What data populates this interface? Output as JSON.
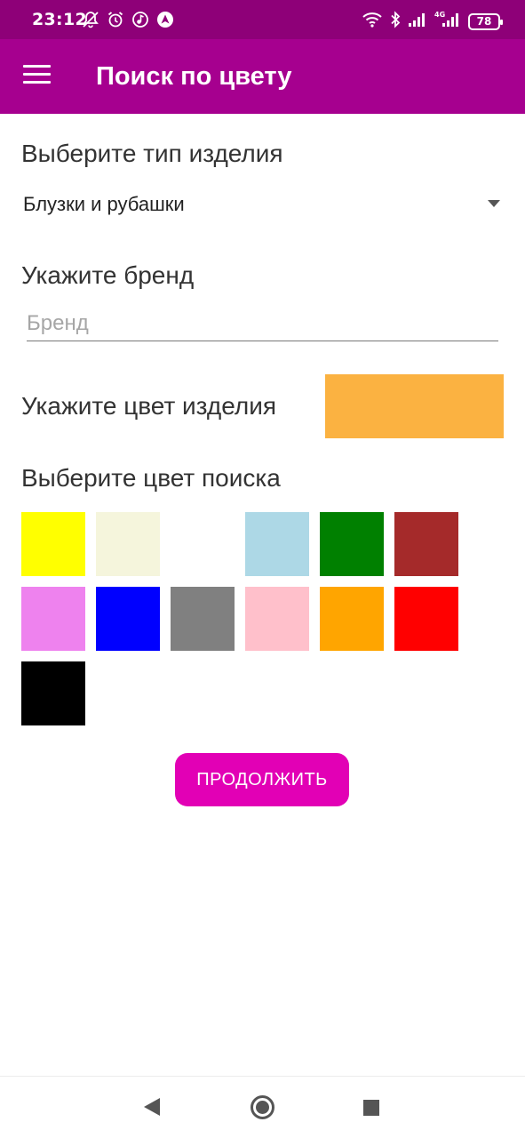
{
  "status_bar": {
    "time": "23:12",
    "battery": "78",
    "network": "4G",
    "left_icons": [
      "notifications-off-icon",
      "alarm-icon",
      "music-icon",
      "nav-app-icon"
    ],
    "right_icons": [
      "wifi-icon",
      "bluetooth-icon",
      "signal-icon",
      "signal-4g-icon",
      "battery-icon"
    ]
  },
  "app_bar": {
    "title": "Поиск по цвету",
    "menu_icon": "menu-icon",
    "background": "#a6008f"
  },
  "form": {
    "type_label": "Выберите тип изделия",
    "type_value": "Блузки и рубашки",
    "brand_label": "Укажите бренд",
    "brand_placeholder": "Бренд",
    "brand_value": "",
    "color_label": "Укажите цвет изделия",
    "selected_color": "#fbb241",
    "search_label": "Выберите цвет поиска"
  },
  "palette": [
    "#ffff00",
    "#f5f5dc",
    "#ffffff",
    "#add8e6",
    "#008000",
    "#a52a2a",
    "#ee82ee",
    "#0000ff",
    "#808080",
    "#ffc0cb",
    "#ffa500",
    "#ff0000",
    "#000000"
  ],
  "continue_button": {
    "label": "ПРОДОЛЖИТЬ",
    "color": "#e200b5"
  },
  "nav_bar": {
    "icons": [
      "back-icon",
      "home-icon",
      "recents-icon"
    ]
  }
}
